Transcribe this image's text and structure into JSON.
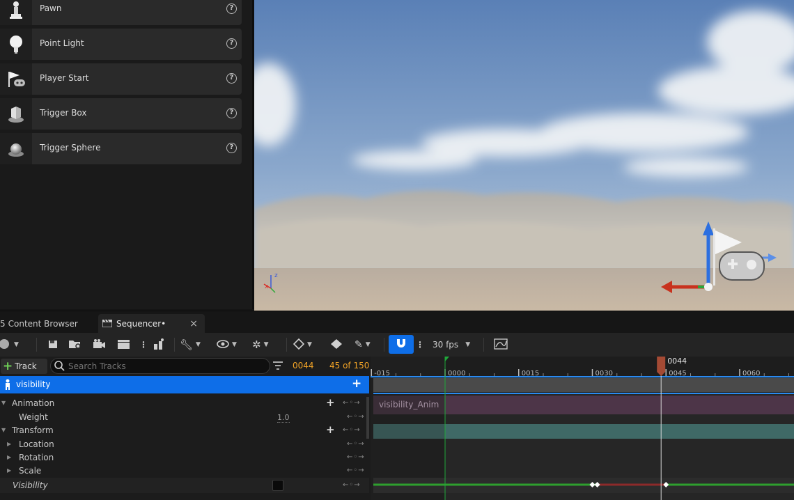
{
  "place_actors": {
    "items": [
      {
        "label": "Pawn",
        "icon": "pawn-icon"
      },
      {
        "label": "Point Light",
        "icon": "point-light-icon"
      },
      {
        "label": "Player Start",
        "icon": "player-start-icon"
      },
      {
        "label": "Trigger Box",
        "icon": "trigger-box-icon"
      },
      {
        "label": "Trigger Sphere",
        "icon": "trigger-sphere-icon"
      }
    ],
    "help_glyph": "?"
  },
  "tabs": {
    "content_browser": "Content Browser",
    "sequencer": "Sequencer•",
    "close_glyph": "×"
  },
  "toolbar": {
    "fps": "30 fps",
    "add_track": "Track",
    "search_placeholder": "Search Tracks",
    "current_frame": "0044",
    "frame_count": "45 of 150"
  },
  "tree": {
    "root": "visibility",
    "animation": "Animation",
    "weight": "Weight",
    "weight_value": "1.0",
    "transform": "Transform",
    "location": "Location",
    "rotation": "Rotation",
    "scale": "Scale",
    "visibility": "Visibility",
    "plus_glyph": "+",
    "kf_nav": "←◦→"
  },
  "timeline": {
    "ticks": [
      "-015",
      "0000",
      "0015",
      "0030",
      "0045",
      "0060"
    ],
    "playhead_frame": "0044",
    "anim_section": "visibility_Anim",
    "visibility_keyframes": [
      30,
      31,
      45
    ],
    "playhead": 44
  },
  "colors": {
    "accent": "#0e6ee8",
    "anim_section": "#4d3548",
    "transform_section": "#3f6966",
    "playhead": "#a44a34",
    "visibility_on": "#2e9f2e",
    "visibility_off": "#8d2a2a"
  }
}
